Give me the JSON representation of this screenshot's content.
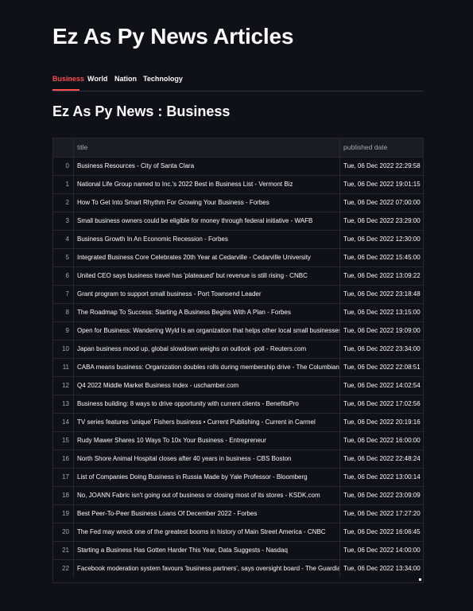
{
  "page": {
    "title": "Ez As Py News Articles"
  },
  "tabs": [
    {
      "label": "Business"
    },
    {
      "label": "World"
    },
    {
      "label": "Nation"
    },
    {
      "label": "Technology"
    }
  ],
  "section": {
    "heading": "Ez As Py News : Business"
  },
  "colors": {
    "accent": "#ff4b4b",
    "background": "#0e1117",
    "text": "#fafafa",
    "muted": "#a3a8b8",
    "border": "#262730"
  },
  "table": {
    "columns": [
      "title",
      "published date"
    ],
    "rows": [
      {
        "index": "0",
        "title": "Business Resources - City of Santa Clara",
        "published": "Tue, 06 Dec 2022 22:29:58"
      },
      {
        "index": "1",
        "title": "National Life Group named to Inc.'s 2022 Best in Business List - Vermont Biz",
        "published": "Tue, 06 Dec 2022 19:01:15"
      },
      {
        "index": "2",
        "title": "How To Get Into Smart Rhythm For Growing Your Business - Forbes",
        "published": "Tue, 06 Dec 2022 07:00:00"
      },
      {
        "index": "3",
        "title": "Small business owners could be eligible for money through federal initiative - WAFB",
        "published": "Tue, 06 Dec 2022 23:29:00"
      },
      {
        "index": "4",
        "title": "Business Growth In An Economic Recession - Forbes",
        "published": "Tue, 06 Dec 2022 12:30:00"
      },
      {
        "index": "5",
        "title": "Integrated Business Core Celebrates 20th Year at Cedarville - Cedarville University",
        "published": "Tue, 06 Dec 2022 15:45:00"
      },
      {
        "index": "6",
        "title": "United CEO says business travel has 'plateaued' but revenue is still rising - CNBC",
        "published": "Tue, 06 Dec 2022 13:09:22"
      },
      {
        "index": "7",
        "title": "Grant program to support small business - Port Townsend Leader",
        "published": "Tue, 06 Dec 2022 23:18:48"
      },
      {
        "index": "8",
        "title": "The Roadmap To Success: Starting A Business Begins With A Plan - Forbes",
        "published": "Tue, 06 Dec 2022 13:15:00"
      },
      {
        "index": "9",
        "title": "Open for Business: Wandering Wyld is an organization that helps other local small businesses",
        "published": "Tue, 06 Dec 2022 19:09:00"
      },
      {
        "index": "10",
        "title": "Japan business mood up, global slowdown weighs on outlook -poll - Reuters.com",
        "published": "Tue, 06 Dec 2022 23:34:00"
      },
      {
        "index": "11",
        "title": "CABA means business: Organization doubles rolls during membership drive - The Columbian",
        "published": "Tue, 06 Dec 2022 22:08:51"
      },
      {
        "index": "12",
        "title": "Q4 2022 Middle Market Business Index - uschamber.com",
        "published": "Tue, 06 Dec 2022 14:02:54"
      },
      {
        "index": "13",
        "title": "Business building: 8 ways to drive opportunity with current clients - BenefitsPro",
        "published": "Tue, 06 Dec 2022 17:02:56"
      },
      {
        "index": "14",
        "title": "TV series features 'unique' Fishers business • Current Publishing - Current in Carmel",
        "published": "Tue, 06 Dec 2022 20:19:16"
      },
      {
        "index": "15",
        "title": "Rudy Mawer Shares 10 Ways To 10x Your Business - Entrepreneur",
        "published": "Tue, 06 Dec 2022 16:00:00"
      },
      {
        "index": "16",
        "title": "North Shore Animal Hospital closes after 40 years in business - CBS Boston",
        "published": "Tue, 06 Dec 2022 22:48:24"
      },
      {
        "index": "17",
        "title": "List of Companies Doing Business in Russia Made by Yale Professor - Bloomberg",
        "published": "Tue, 06 Dec 2022 13:00:14"
      },
      {
        "index": "18",
        "title": "No, JOANN Fabric isn't going out of business or closing most of its stores - KSDK.com",
        "published": "Tue, 06 Dec 2022 23:09:09"
      },
      {
        "index": "19",
        "title": "Best Peer-To-Peer Business Loans Of December 2022 - Forbes",
        "published": "Tue, 06 Dec 2022 17:27:20"
      },
      {
        "index": "20",
        "title": "The Fed may wreck one of the greatest booms in history of Main Street America - CNBC",
        "published": "Tue, 06 Dec 2022 16:06:45"
      },
      {
        "index": "21",
        "title": "Starting a Business Has Gotten Harder This Year, Data Suggests - Nasdaq",
        "published": "Tue, 06 Dec 2022 14:00:00"
      },
      {
        "index": "22",
        "title": "Facebook moderation system favours 'business partners', says oversight board - The Guardian",
        "published": "Tue, 06 Dec 2022 13:34:00"
      }
    ]
  }
}
